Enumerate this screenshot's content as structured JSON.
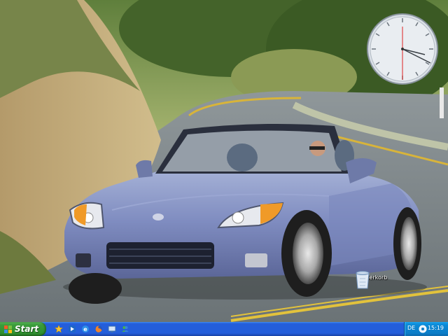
{
  "desktop": {
    "icons": [
      {
        "label": "Papierkorb",
        "icon": "recycle-bin-icon"
      }
    ],
    "clock_gadget": {
      "icon": "analog-clock-icon"
    }
  },
  "taskbar": {
    "start_label": "Start",
    "quick_launch": [
      {
        "icon": "favorites-star-icon"
      },
      {
        "icon": "media-player-icon"
      },
      {
        "icon": "internet-explorer-icon"
      },
      {
        "icon": "firefox-icon"
      },
      {
        "icon": "show-desktop-icon"
      },
      {
        "icon": "messenger-icon"
      }
    ],
    "tray": {
      "language": "DE",
      "time": "15:19"
    }
  },
  "colors": {
    "taskbar_blue": "#245edb",
    "start_green": "#3c9d3c",
    "tray_blue": "#0d8ad6"
  }
}
